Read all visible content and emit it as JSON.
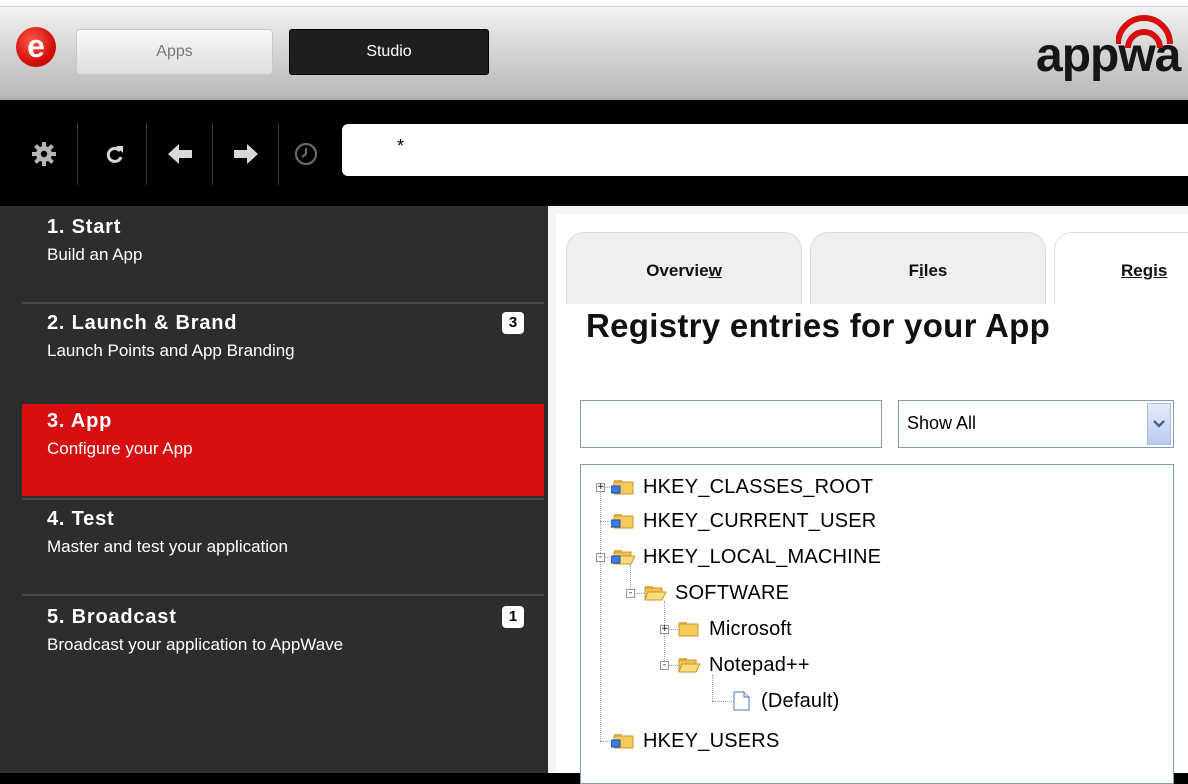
{
  "header": {
    "logo_letter": "e",
    "tabs": [
      {
        "label": "Apps"
      },
      {
        "label": "Studio"
      }
    ],
    "brand": "appwa"
  },
  "toolbar": {
    "address_value": "*"
  },
  "sidebar": {
    "items": [
      {
        "title": "1. Start",
        "subtitle": "Build an App",
        "badge": ""
      },
      {
        "title": "2. Launch & Brand",
        "subtitle": "Launch Points and App Branding",
        "badge": "3"
      },
      {
        "title": "3. App",
        "subtitle": "Configure your App",
        "badge": ""
      },
      {
        "title": "4. Test",
        "subtitle": "Master and test your application",
        "badge": ""
      },
      {
        "title": "5. Broadcast",
        "subtitle": "Broadcast your application to AppWave",
        "badge": "1"
      }
    ],
    "active_index": 2,
    "active_color": "#d50f0f"
  },
  "main": {
    "tabs": [
      {
        "label_pre": "Overvie",
        "label_u": "w",
        "label_post": ""
      },
      {
        "label_pre": "F",
        "label_u": "i",
        "label_post": "les"
      },
      {
        "label_pre": "Regis",
        "label_u": "",
        "label_post": ""
      }
    ],
    "heading": "Registry entries for your App",
    "filter": {
      "value": "",
      "select_value": "Show All"
    },
    "tree": [
      {
        "label": "HKEY_CLASSES_ROOT",
        "icon": "registry-folder-icon",
        "expander": "+"
      },
      {
        "label": "HKEY_CURRENT_USER",
        "icon": "registry-folder-icon",
        "expander": ""
      },
      {
        "label": "HKEY_LOCAL_MACHINE",
        "icon": "registry-folder-open-icon",
        "expander": "-"
      },
      {
        "label": "SOFTWARE",
        "icon": "folder-open-icon",
        "expander": "-"
      },
      {
        "label": "Microsoft",
        "icon": "folder-icon",
        "expander": "+"
      },
      {
        "label": "Notepad++",
        "icon": "folder-open-icon",
        "expander": "-"
      },
      {
        "label": "(Default)",
        "icon": "file-icon",
        "expander": ""
      },
      {
        "label": "HKEY_USERS",
        "icon": "registry-folder-icon",
        "expander": ""
      }
    ]
  }
}
